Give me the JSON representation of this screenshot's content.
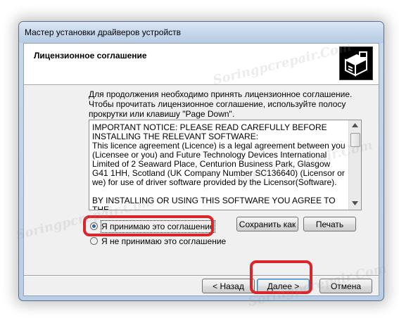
{
  "window": {
    "title": "Мастер установки драйверов устройств"
  },
  "header": {
    "title": "Лицензионное соглашение",
    "icon": "installer-box-icon"
  },
  "instructions": "Для продолжения необходимо принять лицензионное соглашение. Чтобы прочитать лицензионное соглашение, используйте полосу прокрутки или клавишу \"Page Down\".",
  "license": {
    "text": "IMPORTANT NOTICE: PLEASE READ CAREFULLY BEFORE\nINSTALLING THE RELEVANT SOFTWARE:\nThis licence agreement (Licence) is a legal agreement between you (Licensee or you) and Future Technology Devices International Limited of 2 Seaward Place, Centurion Business Park, Glasgow G41 1HH, Scotland (UK Company Number SC136640) (Licensor or we) for use of driver software provided by the Licensor(Software).\n\nBY INSTALLING OR USING THIS SOFTWARE YOU AGREE TO THE"
  },
  "options": {
    "accept": "Я принимаю это соглашение",
    "decline": "Я не принимаю это соглашение",
    "selected": "accept"
  },
  "buttons": {
    "save": "Сохранить как",
    "print": "Печать",
    "back": "< Назад",
    "next": "Далее >",
    "cancel": "Отмена"
  },
  "watermark": "Soringpcrepair.Com",
  "colors": {
    "highlight": "#d9262b",
    "radio_selected": "#2f62a7"
  }
}
